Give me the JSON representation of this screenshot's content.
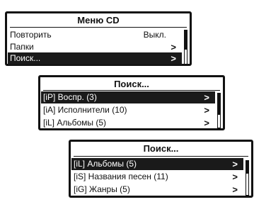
{
  "screens": [
    {
      "title": "Меню CD",
      "items": [
        {
          "label": "Повторить",
          "value": "Выкл.",
          "arrow": ""
        },
        {
          "label": "Папки",
          "value": "",
          "arrow": ">"
        },
        {
          "label": "Поиск...",
          "value": "",
          "arrow": ">"
        }
      ],
      "selected_index": 2
    },
    {
      "title": "Поиск...",
      "items": [
        {
          "label": "[iP] Воспр. (3)",
          "arrow": ">"
        },
        {
          "label": "[iA] Исполнители (10)",
          "arrow": ">"
        },
        {
          "label": "[iL] Альбомы (5)",
          "arrow": ">"
        }
      ],
      "selected_index": 0
    },
    {
      "title": "Поиск...",
      "items": [
        {
          "label": "[iL] Альбомы (5)",
          "arrow": ">"
        },
        {
          "label": "[iS] Названия песен (11)",
          "arrow": ">"
        },
        {
          "label": "[iG] Жанры (5)",
          "arrow": ">"
        }
      ],
      "selected_index": 0
    }
  ],
  "icons": {
    "arrow": "chevron-right-icon"
  },
  "colors": {
    "background": "#ffffff",
    "frame": "#111111",
    "selection": "#1a1a1a",
    "selection_text": "#ffffff"
  }
}
